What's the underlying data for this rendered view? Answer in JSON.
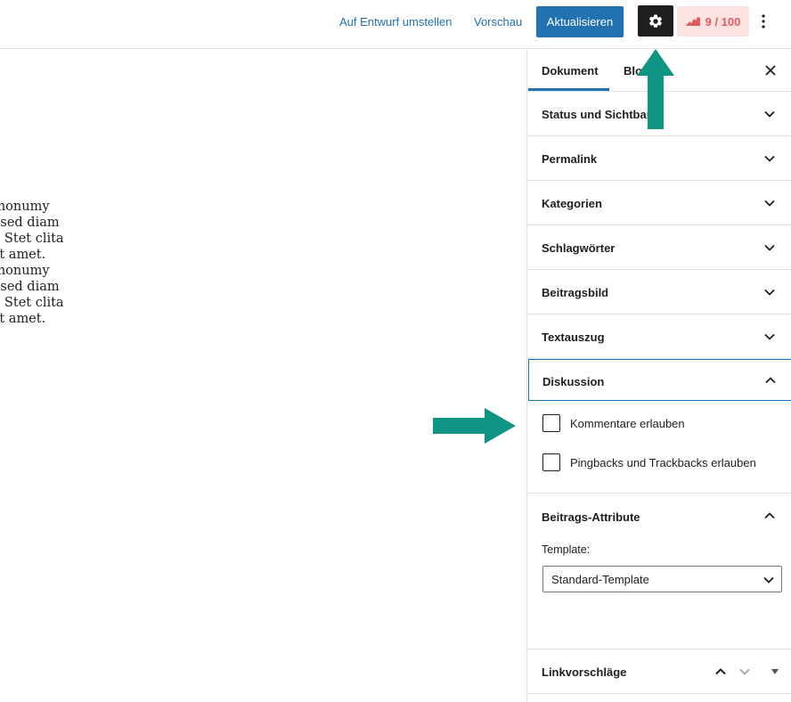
{
  "toolbar": {
    "switch_to_draft": "Auf Entwurf umstellen",
    "preview": "Vorschau",
    "update": "Aktualisieren",
    "settings_icon": "gear-icon",
    "score": "9 / 100",
    "score_icon": "seo-score-icon",
    "more_icon": "more-vertical-icon"
  },
  "content": {
    "lines": [
      "sed diam nonumy",
      "yam erat, sed diam",
      "ea rebum. Stet clita",
      "m dolor sit amet.",
      "sed diam nonumy",
      "yam erat, sed diam",
      "ea rebum. Stet clita",
      "m dolor sit amet."
    ]
  },
  "sidebar": {
    "tabs": {
      "document": "Dokument",
      "block": "Blo",
      "close_icon": "close-icon"
    },
    "panels": [
      {
        "title": "Status und Sichtbark",
        "expanded": false
      },
      {
        "title": "Permalink",
        "expanded": false
      },
      {
        "title": "Kategorien",
        "expanded": false
      },
      {
        "title": "Schlagwörter",
        "expanded": false
      },
      {
        "title": "Beitragsbild",
        "expanded": false
      },
      {
        "title": "Textauszug",
        "expanded": false
      },
      {
        "title": "Diskussion",
        "expanded": true
      },
      {
        "title": "Beitrags-Attribute",
        "expanded": true
      },
      {
        "title": "Linkvorschläge",
        "expanded": false
      }
    ],
    "discussion": {
      "allow_comments": "Kommentare erlauben",
      "allow_comments_checked": false,
      "allow_pingbacks": "Pingbacks und Trackbacks erlauben",
      "allow_pingbacks_checked": false
    },
    "attributes": {
      "template_label": "Template:",
      "template_value": "Standard-Template"
    }
  },
  "colors": {
    "accent": "#2271b1",
    "dark": "#1e1e1e",
    "score_bg": "#fbe3e3",
    "score_fg": "#e05c5c",
    "annotation_arrow": "#0e9482"
  }
}
